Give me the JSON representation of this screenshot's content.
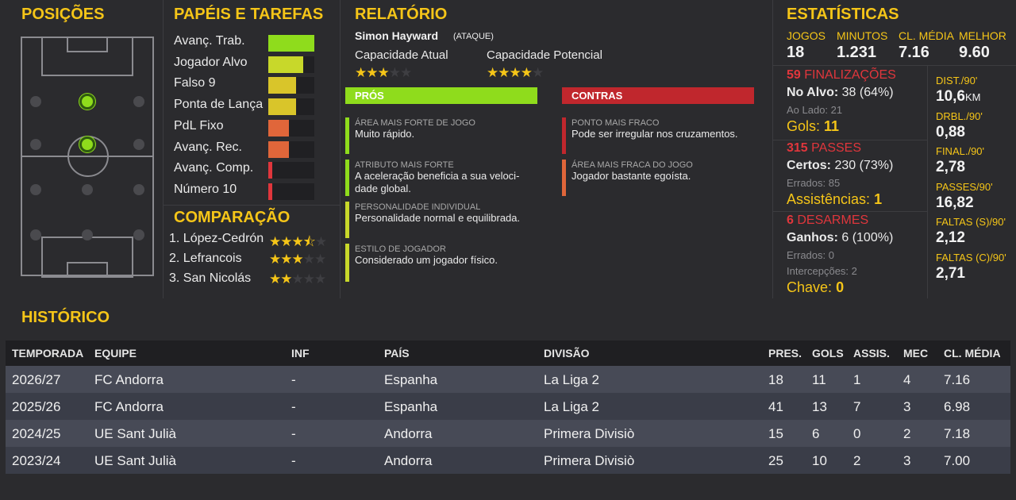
{
  "positions": {
    "title": "POSIÇÕES",
    "active_dots": [
      [
        110,
        128
      ],
      [
        110,
        182
      ]
    ]
  },
  "roles": {
    "title": "PAPÉIS E TAREFAS",
    "items": [
      {
        "label": "Avanç. Trab.",
        "fill": 1.0,
        "color": "#8fdc1c"
      },
      {
        "label": "Jogador Alvo",
        "fill": 0.75,
        "color": "#c8d82a"
      },
      {
        "label": "Falso 9",
        "fill": 0.6,
        "color": "#d9c52a"
      },
      {
        "label": "Ponta de Lança",
        "fill": 0.6,
        "color": "#d9c52a"
      },
      {
        "label": "PdL Fixo",
        "fill": 0.45,
        "color": "#e0663a"
      },
      {
        "label": "Avanç. Rec.",
        "fill": 0.45,
        "color": "#e0663a"
      },
      {
        "label": "Avanç. Comp.",
        "fill": 0.08,
        "color": "#e0363c"
      },
      {
        "label": "Número 10",
        "fill": 0.08,
        "color": "#e0363c"
      }
    ]
  },
  "comparison": {
    "title": "COMPARAÇÃO",
    "items": [
      {
        "label": "1. López-Cedrón",
        "stars": 3.5
      },
      {
        "label": "2. Lefrancois",
        "stars": 3
      },
      {
        "label": "3. San Nicolás",
        "stars": 2
      }
    ]
  },
  "report": {
    "title": "RELATÓRIO",
    "player": "Simon Hayward",
    "position": "(ATAQUE)",
    "current_label": "Capacidade Atual",
    "current_stars": 3,
    "potential_label": "Capacidade Potencial",
    "potential_stars": 4,
    "pros_label": "PRÓS",
    "cons_label": "CONTRAS",
    "pros": [
      {
        "label": "ÁREA MAIS FORTE DE JOGO",
        "text": "Muito rápido.",
        "color": "#8fdc1c"
      },
      {
        "label": "ATRIBUTO MAIS FORTE",
        "text": "A aceleração beneficia a sua veloci-",
        "text2": "dade global.",
        "color": "#8fdc1c"
      },
      {
        "label": "PERSONALIDADE INDIVIDUAL",
        "text": "Personalidade normal e equilibrada.",
        "color": "#c8d82a"
      },
      {
        "label": "ESTILO DE JOGADOR",
        "text": "Considerado um jogador físico.",
        "color": "#c8d82a"
      }
    ],
    "cons": [
      {
        "label": "PONTO MAIS FRACO",
        "text": "Pode ser irregular nos cruzamentos.",
        "color": "#c0272d"
      },
      {
        "label": "ÁREA MAIS FRACA DO JOGO",
        "text": "Jogador bastante egoísta.",
        "color": "#e0663a"
      }
    ]
  },
  "stats": {
    "title": "ESTATÍSTICAS",
    "top": [
      {
        "label": "JOGOS",
        "value": "18"
      },
      {
        "label": "MINUTOS",
        "value": "1.231"
      },
      {
        "label": "CL. MÉDIA",
        "value": "7.16"
      },
      {
        "label": "MELHOR",
        "value": "9.60"
      }
    ],
    "shots_count": "59",
    "shots_label": "FINALIZAÇÕES",
    "on_target_label": "No Alvo:",
    "on_target_value": "38 (64%)",
    "wide": "Ao Lado: 21",
    "goals_label": "Gols:",
    "goals_value": "11",
    "passes_count": "315",
    "passes_label": "PASSES",
    "completed_label": "Certos:",
    "completed_value": "230 (73%)",
    "missed": "Errados: 85",
    "assists_label": "Assistências:",
    "assists_value": "1",
    "tackles_count": "6",
    "tackles_label": "DESARMES",
    "won_label": "Ganhos:",
    "won_value": "6 (100%)",
    "t_missed": "Errados: 0",
    "interceptions": "Intercepções: 2",
    "key_label": "Chave:",
    "key_value": "0",
    "right": [
      {
        "label": "DIST./90'",
        "value": "10,6",
        "unit": "KM"
      },
      {
        "label": "DRBL./90'",
        "value": "0,88"
      },
      {
        "label": "FINAL./90'",
        "value": "2,78"
      },
      {
        "label": "PASSES/90'",
        "value": "16,82"
      },
      {
        "label": "FALTAS (S)/90'",
        "value": "2,12"
      },
      {
        "label": "FALTAS (C)/90'",
        "value": "2,71"
      }
    ]
  },
  "history": {
    "title": "HISTÓRICO",
    "headers": [
      "TEMPORADA",
      "EQUIPE",
      "INF",
      "PAÍS",
      "DIVISÃO",
      "PRES.",
      "GOLS",
      "ASSIS.",
      "MEC",
      "CL. MÉDIA"
    ],
    "rows": [
      [
        "2026/27",
        "FC Andorra",
        "-",
        "Espanha",
        "La Liga 2",
        "18",
        "11",
        "1",
        "4",
        "7.16"
      ],
      [
        "2025/26",
        "FC Andorra",
        "-",
        "Espanha",
        "La Liga 2",
        "41",
        "13",
        "7",
        "3",
        "6.98"
      ],
      [
        "2024/25",
        "UE Sant Julià",
        "-",
        "Andorra",
        "Primera Divisiò",
        "15",
        "6",
        "0",
        "2",
        "7.18"
      ],
      [
        "2023/24",
        "UE Sant Julià",
        "-",
        "Andorra",
        "Primera Divisiò",
        "25",
        "10",
        "2",
        "3",
        "7.00"
      ]
    ]
  }
}
